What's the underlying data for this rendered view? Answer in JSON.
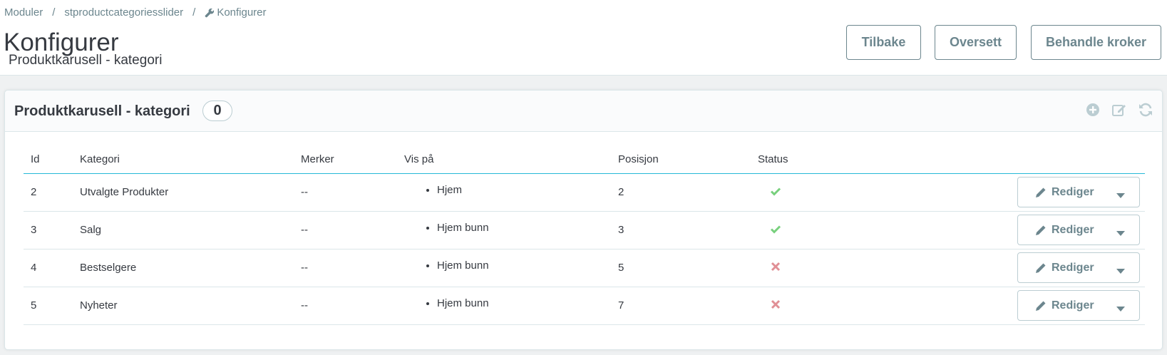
{
  "breadcrumb": {
    "items": [
      "Moduler",
      "stproductcategoriesslider",
      "Konfigurer"
    ]
  },
  "header": {
    "title": "Konfigurer",
    "subtitle": "Produktkarusell - kategori",
    "buttons": [
      "Tilbake",
      "Oversett",
      "Behandle kroker"
    ]
  },
  "panel": {
    "title": "Produktkarusell - kategori",
    "count": "0",
    "icons": [
      "add-icon",
      "edit-icon",
      "refresh-icon"
    ]
  },
  "table": {
    "columns": [
      "Id",
      "Kategori",
      "Merker",
      "Vis på",
      "Posisjon",
      "Status"
    ],
    "rows": [
      {
        "id": "2",
        "kategori": "Utvalgte Produkter",
        "merker": "--",
        "vis": "Hjem",
        "posisjon": "2",
        "status": "enabled",
        "action": "Rediger"
      },
      {
        "id": "3",
        "kategori": "Salg",
        "merker": "--",
        "vis": "Hjem bunn",
        "posisjon": "3",
        "status": "enabled",
        "action": "Rediger"
      },
      {
        "id": "4",
        "kategori": "Bestselgere",
        "merker": "--",
        "vis": "Hjem bunn",
        "posisjon": "5",
        "status": "disabled",
        "action": "Rediger"
      },
      {
        "id": "5",
        "kategori": "Nyheter",
        "merker": "--",
        "vis": "Hjem bunn",
        "posisjon": "7",
        "status": "disabled",
        "action": "Rediger"
      }
    ]
  },
  "colors": {
    "accent": "#25b9d7",
    "enabled": "#78d07d",
    "disabled": "#e08f95",
    "muted": "#6c868e"
  }
}
